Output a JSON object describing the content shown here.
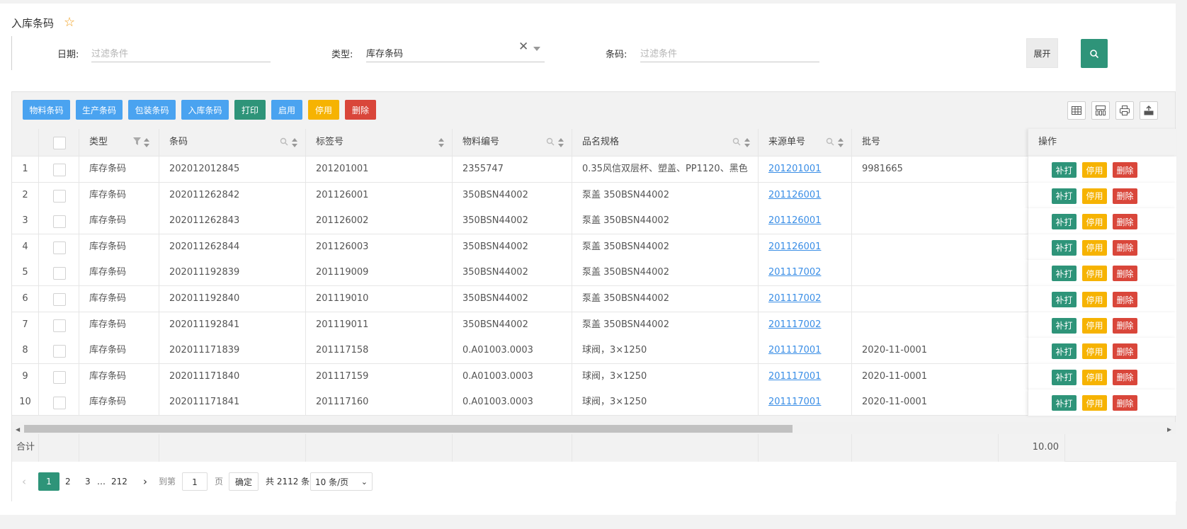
{
  "page": {
    "title": "入库条码"
  },
  "filters": {
    "date_label": "日期:",
    "date_placeholder": "过滤条件",
    "type_label": "类型:",
    "type_value": "库存条码",
    "code_label": "条码:",
    "code_placeholder": "过滤条件",
    "expand_label": "展开"
  },
  "toolbar": {
    "buttons": [
      "物料条码",
      "生产条码",
      "包装条码",
      "入库条码",
      "打印",
      "启用",
      "停用",
      "删除"
    ]
  },
  "table": {
    "columns": [
      "类型",
      "条码",
      "标签号",
      "物料编号",
      "品名规格",
      "来源单号",
      "批号",
      "操作"
    ],
    "rows": [
      {
        "n": "1",
        "type": "库存条码",
        "code": "202012012845",
        "label": "201201001",
        "material": "2355747",
        "name": "0.35风信双层杯、塑盖、PP1120、黑色",
        "source": "201201001",
        "batch": "9981665"
      },
      {
        "n": "2",
        "type": "库存条码",
        "code": "202011262842",
        "label": "201126001",
        "material": "350BSN44002",
        "name": "泵盖 350BSN44002",
        "source": "201126001",
        "batch": ""
      },
      {
        "n": "3",
        "type": "库存条码",
        "code": "202011262843",
        "label": "201126002",
        "material": "350BSN44002",
        "name": "泵盖 350BSN44002",
        "source": "201126001",
        "batch": ""
      },
      {
        "n": "4",
        "type": "库存条码",
        "code": "202011262844",
        "label": "201126003",
        "material": "350BSN44002",
        "name": "泵盖 350BSN44002",
        "source": "201126001",
        "batch": ""
      },
      {
        "n": "5",
        "type": "库存条码",
        "code": "202011192839",
        "label": "201119009",
        "material": "350BSN44002",
        "name": "泵盖 350BSN44002",
        "source": "201117002",
        "batch": ""
      },
      {
        "n": "6",
        "type": "库存条码",
        "code": "202011192840",
        "label": "201119010",
        "material": "350BSN44002",
        "name": "泵盖 350BSN44002",
        "source": "201117002",
        "batch": ""
      },
      {
        "n": "7",
        "type": "库存条码",
        "code": "202011192841",
        "label": "201119011",
        "material": "350BSN44002",
        "name": "泵盖 350BSN44002",
        "source": "201117002",
        "batch": ""
      },
      {
        "n": "8",
        "type": "库存条码",
        "code": "202011171839",
        "label": "201117158",
        "material": "0.A01003.0003",
        "name": "球阀，3×1250",
        "source": "201117001",
        "batch": "2020-11-0001"
      },
      {
        "n": "9",
        "type": "库存条码",
        "code": "202011171840",
        "label": "201117159",
        "material": "0.A01003.0003",
        "name": "球阀，3×1250",
        "source": "201117001",
        "batch": "2020-11-0001"
      },
      {
        "n": "10",
        "type": "库存条码",
        "code": "202011171841",
        "label": "201117160",
        "material": "0.A01003.0003",
        "name": "球阀，3×1250",
        "source": "201117001",
        "batch": "2020-11-0001"
      }
    ],
    "row_actions": [
      "补打",
      "停用",
      "删除"
    ]
  },
  "summary": {
    "label": "合计",
    "total": "10.00"
  },
  "pager": {
    "pages": [
      "1",
      "2",
      "3"
    ],
    "ellipsis": "…",
    "last_page": "212",
    "goto_label": "到第",
    "goto_value": "1",
    "page_unit": "页",
    "confirm_label": "确定",
    "total_text": "共 2112 条",
    "page_size": "10 条/页"
  },
  "colors": {
    "primary": "#2e9479",
    "blue": "#4aa3f0",
    "yellow": "#f6b302",
    "red": "#d9463a",
    "link": "#3a8ee6"
  }
}
